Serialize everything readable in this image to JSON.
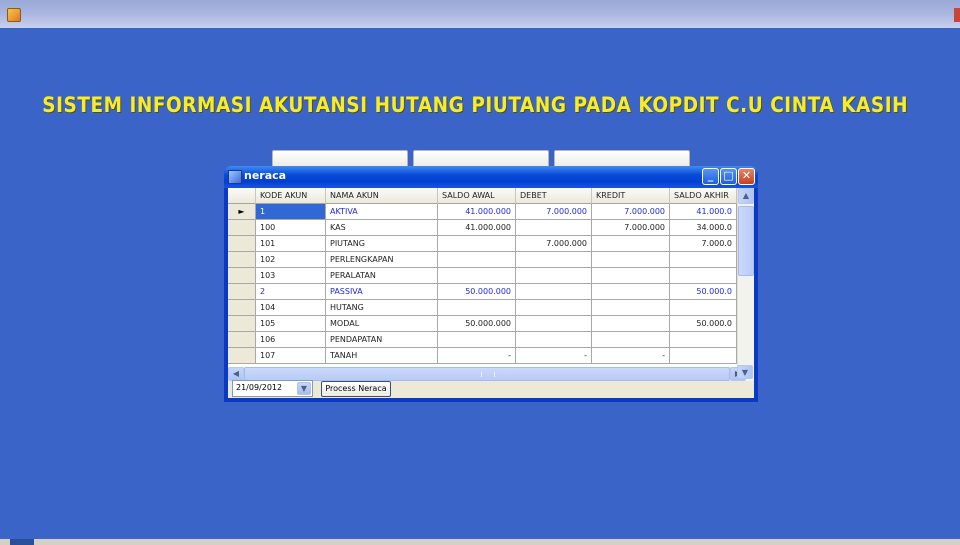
{
  "app": {
    "title": "SISTEM INFORMASI AKUTANSI HUTANG PIUTANG PADA KOPDIT C.U CINTA KASIH"
  },
  "dialog": {
    "title": "neraca",
    "columns": [
      "KODE AKUN",
      "NAMA AKUN",
      "SALDO AWAL",
      "DEBET",
      "KREDIT",
      "SALDO AKHIR"
    ],
    "rows": [
      {
        "kode": "1",
        "nama": "AKTIVA",
        "awal": "41.000.000",
        "debet": "7.000.000",
        "kredit": "7.000.000",
        "akhir": "41.000.0"
      },
      {
        "kode": "100",
        "nama": "KAS",
        "awal": "41.000.000",
        "debet": "",
        "kredit": "7.000.000",
        "akhir": "34.000.0"
      },
      {
        "kode": "101",
        "nama": "PIUTANG",
        "awal": "",
        "debet": "7.000.000",
        "kredit": "",
        "akhir": "7.000.0"
      },
      {
        "kode": "102",
        "nama": "PERLENGKAPAN",
        "awal": "",
        "debet": "",
        "kredit": "",
        "akhir": ""
      },
      {
        "kode": "103",
        "nama": "PERALATAN",
        "awal": "",
        "debet": "",
        "kredit": "",
        "akhir": ""
      },
      {
        "kode": "2",
        "nama": "PASSIVA",
        "awal": "50.000.000",
        "debet": "",
        "kredit": "",
        "akhir": "50.000.0"
      },
      {
        "kode": "104",
        "nama": "HUTANG",
        "awal": "",
        "debet": "",
        "kredit": "",
        "akhir": ""
      },
      {
        "kode": "105",
        "nama": "MODAL",
        "awal": "50.000.000",
        "debet": "",
        "kredit": "",
        "akhir": "50.000.0"
      },
      {
        "kode": "106",
        "nama": "PENDAPATAN",
        "awal": "",
        "debet": "",
        "kredit": "",
        "akhir": ""
      },
      {
        "kode": "107",
        "nama": "TANAH",
        "awal": "-",
        "debet": "-",
        "kredit": "-",
        "akhir": ""
      }
    ],
    "row_indicator": "►",
    "date_value": "21/09/2012",
    "process_label": "Process Neraca"
  },
  "colors": {
    "desktop": "#3a64c8",
    "title_yellow": "#f4ec2c",
    "group_row_text": "#1e2ad8",
    "selection": "#3168d5"
  },
  "icons": {
    "app": "app-icon",
    "window": "window-icon",
    "minimize": "minimize-icon",
    "maximize": "maximize-icon",
    "close": "close-icon",
    "dropdown": "chevron-down-icon"
  }
}
